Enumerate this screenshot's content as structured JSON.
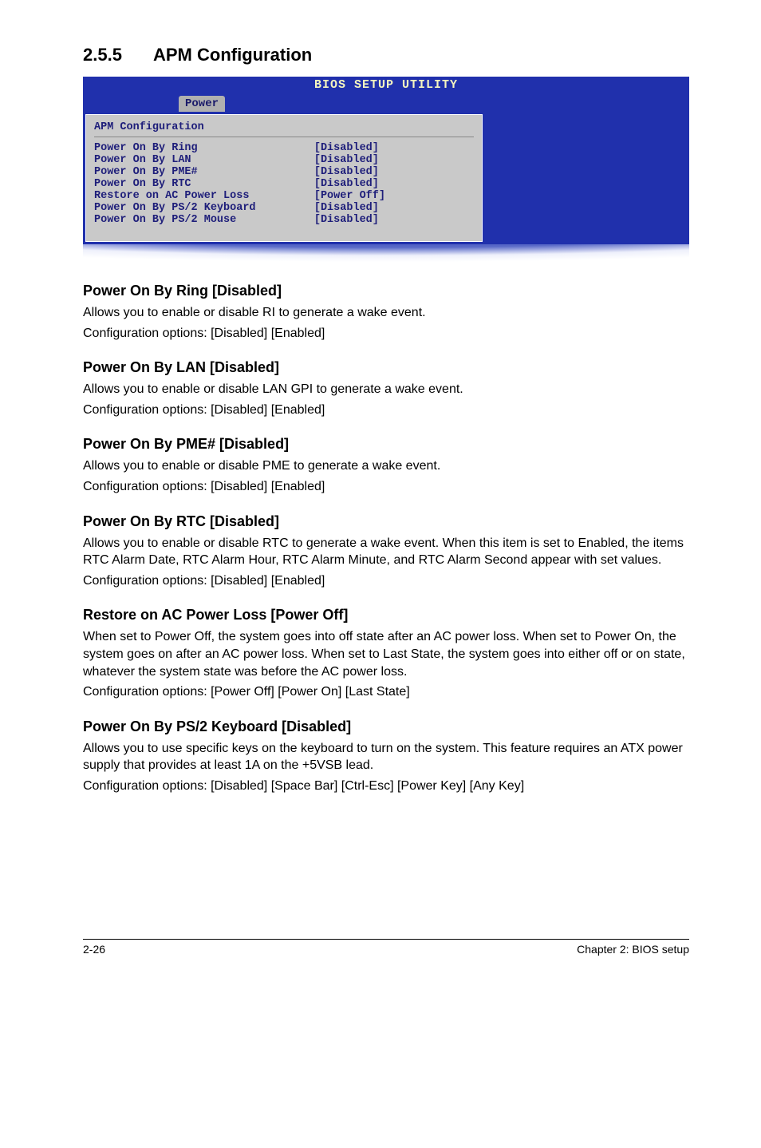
{
  "section": {
    "number": "2.5.5",
    "title": "APM Configuration"
  },
  "bios": {
    "utility_title": "BIOS SETUP UTILITY",
    "tab": "Power",
    "panel_heading": "APM Configuration",
    "rows": [
      {
        "label": "Power On By Ring",
        "value": "[Disabled]"
      },
      {
        "label": "Power On By LAN",
        "value": "[Disabled]"
      },
      {
        "label": "Power On By PME#",
        "value": "[Disabled]"
      },
      {
        "label": "Power On By RTC",
        "value": "[Disabled]"
      },
      {
        "label": "Restore on AC Power Loss",
        "value": "[Power Off]"
      },
      {
        "label": "Power On By PS/2 Keyboard",
        "value": "[Disabled]"
      },
      {
        "label": "Power On By PS/2 Mouse",
        "value": "[Disabled]"
      }
    ]
  },
  "items": [
    {
      "heading": "Power On By Ring [Disabled]",
      "paras": [
        "Allows you to enable or disable RI to generate a wake event.",
        "Configuration options: [Disabled] [Enabled]"
      ]
    },
    {
      "heading": "Power On By LAN [Disabled]",
      "paras": [
        "Allows you to enable or disable LAN GPI to generate a wake event.",
        "Configuration options: [Disabled] [Enabled]"
      ]
    },
    {
      "heading": "Power On By PME# [Disabled]",
      "paras": [
        "Allows you to enable or disable PME to generate a wake event.",
        "Configuration options: [Disabled] [Enabled]"
      ]
    },
    {
      "heading": "Power On By RTC [Disabled]",
      "paras": [
        "Allows you to enable or disable RTC to generate a wake event. When this item is set to Enabled, the items RTC Alarm Date, RTC Alarm Hour, RTC Alarm Minute, and RTC Alarm Second appear with set values.",
        "Configuration options: [Disabled] [Enabled]"
      ]
    },
    {
      "heading": "Restore on AC Power Loss [Power Off]",
      "paras": [
        "When set to Power Off, the system goes into off state after an AC power loss. When set to Power On, the system goes on after an AC power loss. When set to Last State, the system goes into either off or on state, whatever the system state was before the AC power loss.",
        "Configuration options: [Power Off] [Power On] [Last State]"
      ]
    },
    {
      "heading": "Power On By PS/2 Keyboard [Disabled]",
      "paras": [
        "Allows you to use specific keys on the keyboard to turn on the system. This feature requires an ATX power supply that provides at least 1A on the +5VSB lead.",
        "Configuration options: [Disabled] [Space Bar] [Ctrl-Esc] [Power Key] [Any Key]"
      ]
    }
  ],
  "footer": {
    "left": "2-26",
    "right": "Chapter 2: BIOS setup"
  }
}
